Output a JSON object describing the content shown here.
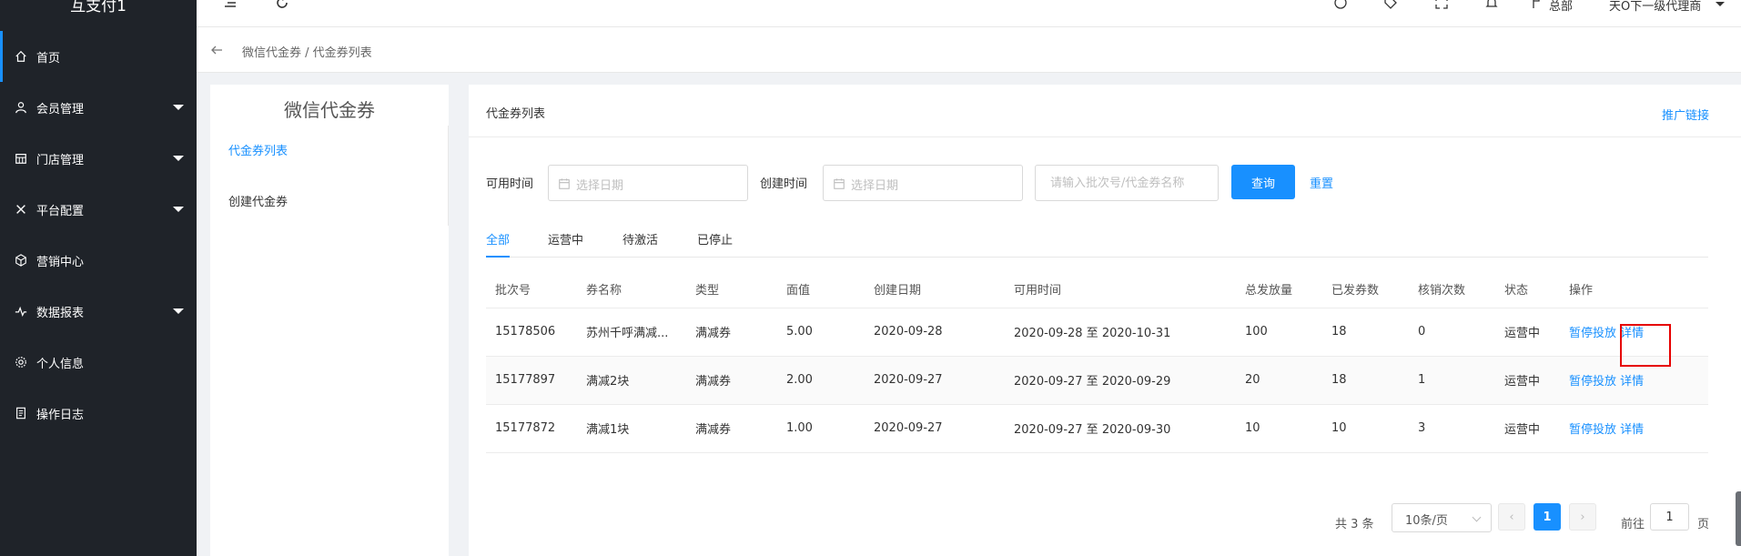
{
  "app": {
    "brand": "互支付1"
  },
  "sidebar": {
    "items": [
      {
        "label": "首页",
        "icon": "home-icon",
        "caret": false
      },
      {
        "label": "会员管理",
        "icon": "user-icon",
        "caret": true
      },
      {
        "label": "门店管理",
        "icon": "store-icon",
        "caret": true
      },
      {
        "label": "平台配置",
        "icon": "tools-icon",
        "caret": true
      },
      {
        "label": "营销中心",
        "icon": "cube-icon",
        "caret": false
      },
      {
        "label": "数据报表",
        "icon": "chart-icon",
        "caret": true
      },
      {
        "label": "个人信息",
        "icon": "gear-icon",
        "caret": false
      },
      {
        "label": "操作日志",
        "icon": "log-icon",
        "caret": false
      }
    ]
  },
  "topbar": {
    "hq_label": "总部",
    "user_label": "天O下一级代理商"
  },
  "breadcrumb": {
    "text": "微信代金券 / 代金券列表"
  },
  "subpanel": {
    "title": "微信代金券",
    "items": [
      "代金券列表",
      "创建代金券"
    ]
  },
  "card": {
    "title": "代金券列表",
    "promo_link": "推广链接",
    "filters": {
      "available_time_label": "可用时间",
      "create_time_label": "创建时间",
      "date_placeholder": "选择日期",
      "search_placeholder": "请输入批次号/代金券名称",
      "query_label": "查询",
      "reset_label": "重置"
    },
    "tabs": [
      "全部",
      "运营中",
      "待激活",
      "已停止"
    ],
    "table": {
      "headers": [
        "批次号",
        "券名称",
        "类型",
        "面值",
        "创建日期",
        "可用时间",
        "总发放量",
        "已发券数",
        "核销次数",
        "状态",
        "操作"
      ],
      "rows": [
        {
          "batch": "15178506",
          "name": "苏州千呼满减...",
          "type": "满减券",
          "value": "5.00",
          "created": "2020-09-28",
          "period": "2020-09-28 至 2020-10-31",
          "total": "100",
          "issued": "18",
          "redeemed": "0",
          "status": "运营中",
          "op_pause": "暂停投放",
          "op_detail": "详情"
        },
        {
          "batch": "15177897",
          "name": "满减2块",
          "type": "满减券",
          "value": "2.00",
          "created": "2020-09-27",
          "period": "2020-09-27 至 2020-09-29",
          "total": "20",
          "issued": "18",
          "redeemed": "1",
          "status": "运营中",
          "op_pause": "暂停投放",
          "op_detail": "详情"
        },
        {
          "batch": "15177872",
          "name": "满减1块",
          "type": "满减券",
          "value": "1.00",
          "created": "2020-09-27",
          "period": "2020-09-27 至 2020-09-30",
          "total": "10",
          "issued": "10",
          "redeemed": "3",
          "status": "运营中",
          "op_pause": "暂停投放",
          "op_detail": "详情"
        }
      ]
    },
    "pagination": {
      "total_text": "共 3 条",
      "page_size": "10条/页",
      "prev": "‹",
      "current_page": "1",
      "next": "›",
      "goto_prefix": "前往",
      "goto_value": "1",
      "goto_suffix": "页"
    }
  },
  "colors": {
    "accent": "#1890ff",
    "sidebar_bg": "#1f2329",
    "status_green": "#52c41a",
    "highlight_red": "#e60000"
  }
}
